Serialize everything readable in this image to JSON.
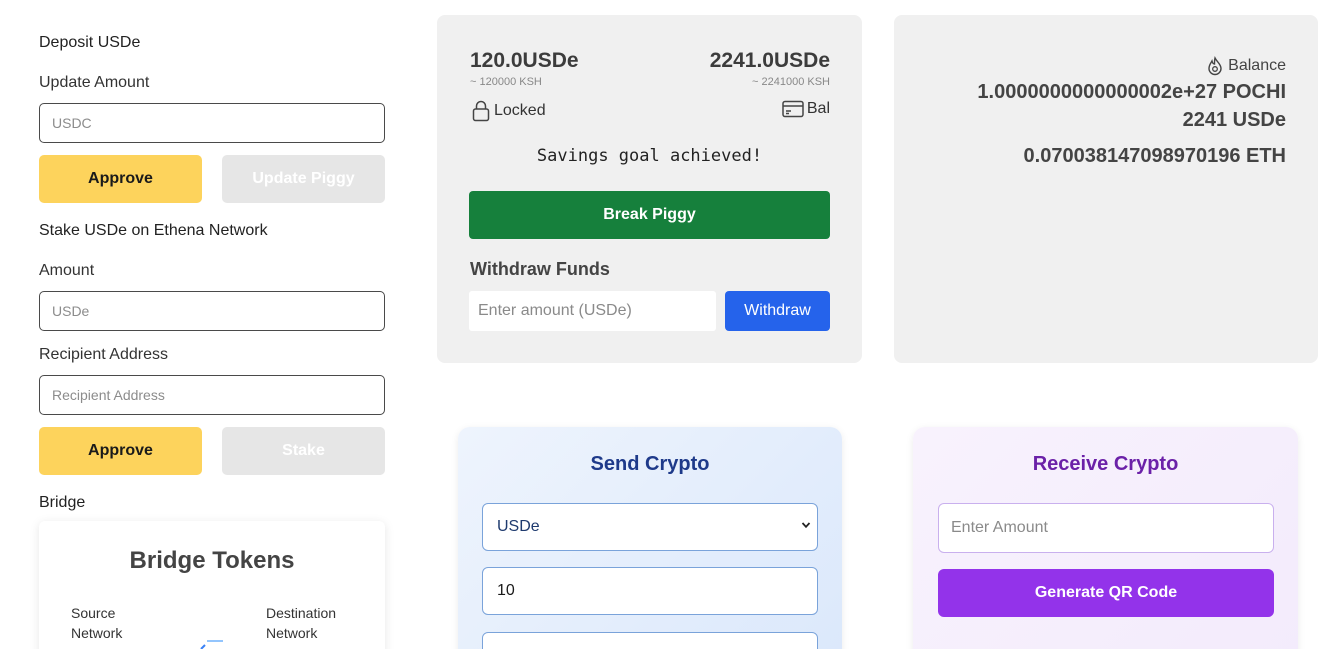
{
  "deposit": {
    "title": "Deposit USDe",
    "update_amount_label": "Update Amount",
    "usdc_placeholder": "USDC",
    "approve_label": "Approve",
    "update_piggy_label": "Update Piggy"
  },
  "stake": {
    "title": "Stake USDe on Ethena Network",
    "amount_label": "Amount",
    "amount_placeholder": "USDe",
    "recipient_label": "Recipient Address",
    "recipient_placeholder": "Recipient Address",
    "approve_label": "Approve",
    "stake_label": "Stake"
  },
  "bridge": {
    "label": "Bridge",
    "title": "Bridge Tokens",
    "source_label": "Source Network",
    "destination_label": "Destination Network"
  },
  "piggy": {
    "locked_amount": "120.0USDe",
    "locked_ksh": "~ 120000 KSH",
    "balance_amount": "2241.0USDe",
    "balance_ksh": "~ 2241000 KSH",
    "locked_label": "Locked",
    "balance_label": "Bal",
    "goal_message": "Savings goal achieved!",
    "break_label": "Break Piggy",
    "withdraw_title": "Withdraw Funds",
    "withdraw_placeholder": "Enter amount (USDe)",
    "withdraw_button": "Withdraw"
  },
  "balance_card": {
    "label": "Balance",
    "pochi": "1.0000000000000002e+27 POCHI",
    "usde": "2241 USDe",
    "eth": "0.070038147098970196 ETH"
  },
  "send": {
    "title": "Send Crypto",
    "token_selected": "USDe",
    "amount_value": "10"
  },
  "receive": {
    "title": "Receive Crypto",
    "amount_placeholder": "Enter Amount",
    "generate_label": "Generate QR Code"
  },
  "colors": {
    "approve_yellow": "#fdd35c",
    "break_green": "#16803c",
    "withdraw_blue": "#2563eb",
    "send_title": "#1e3a8a",
    "receive_title": "#6b21a8",
    "qr_purple": "#9333ea"
  }
}
